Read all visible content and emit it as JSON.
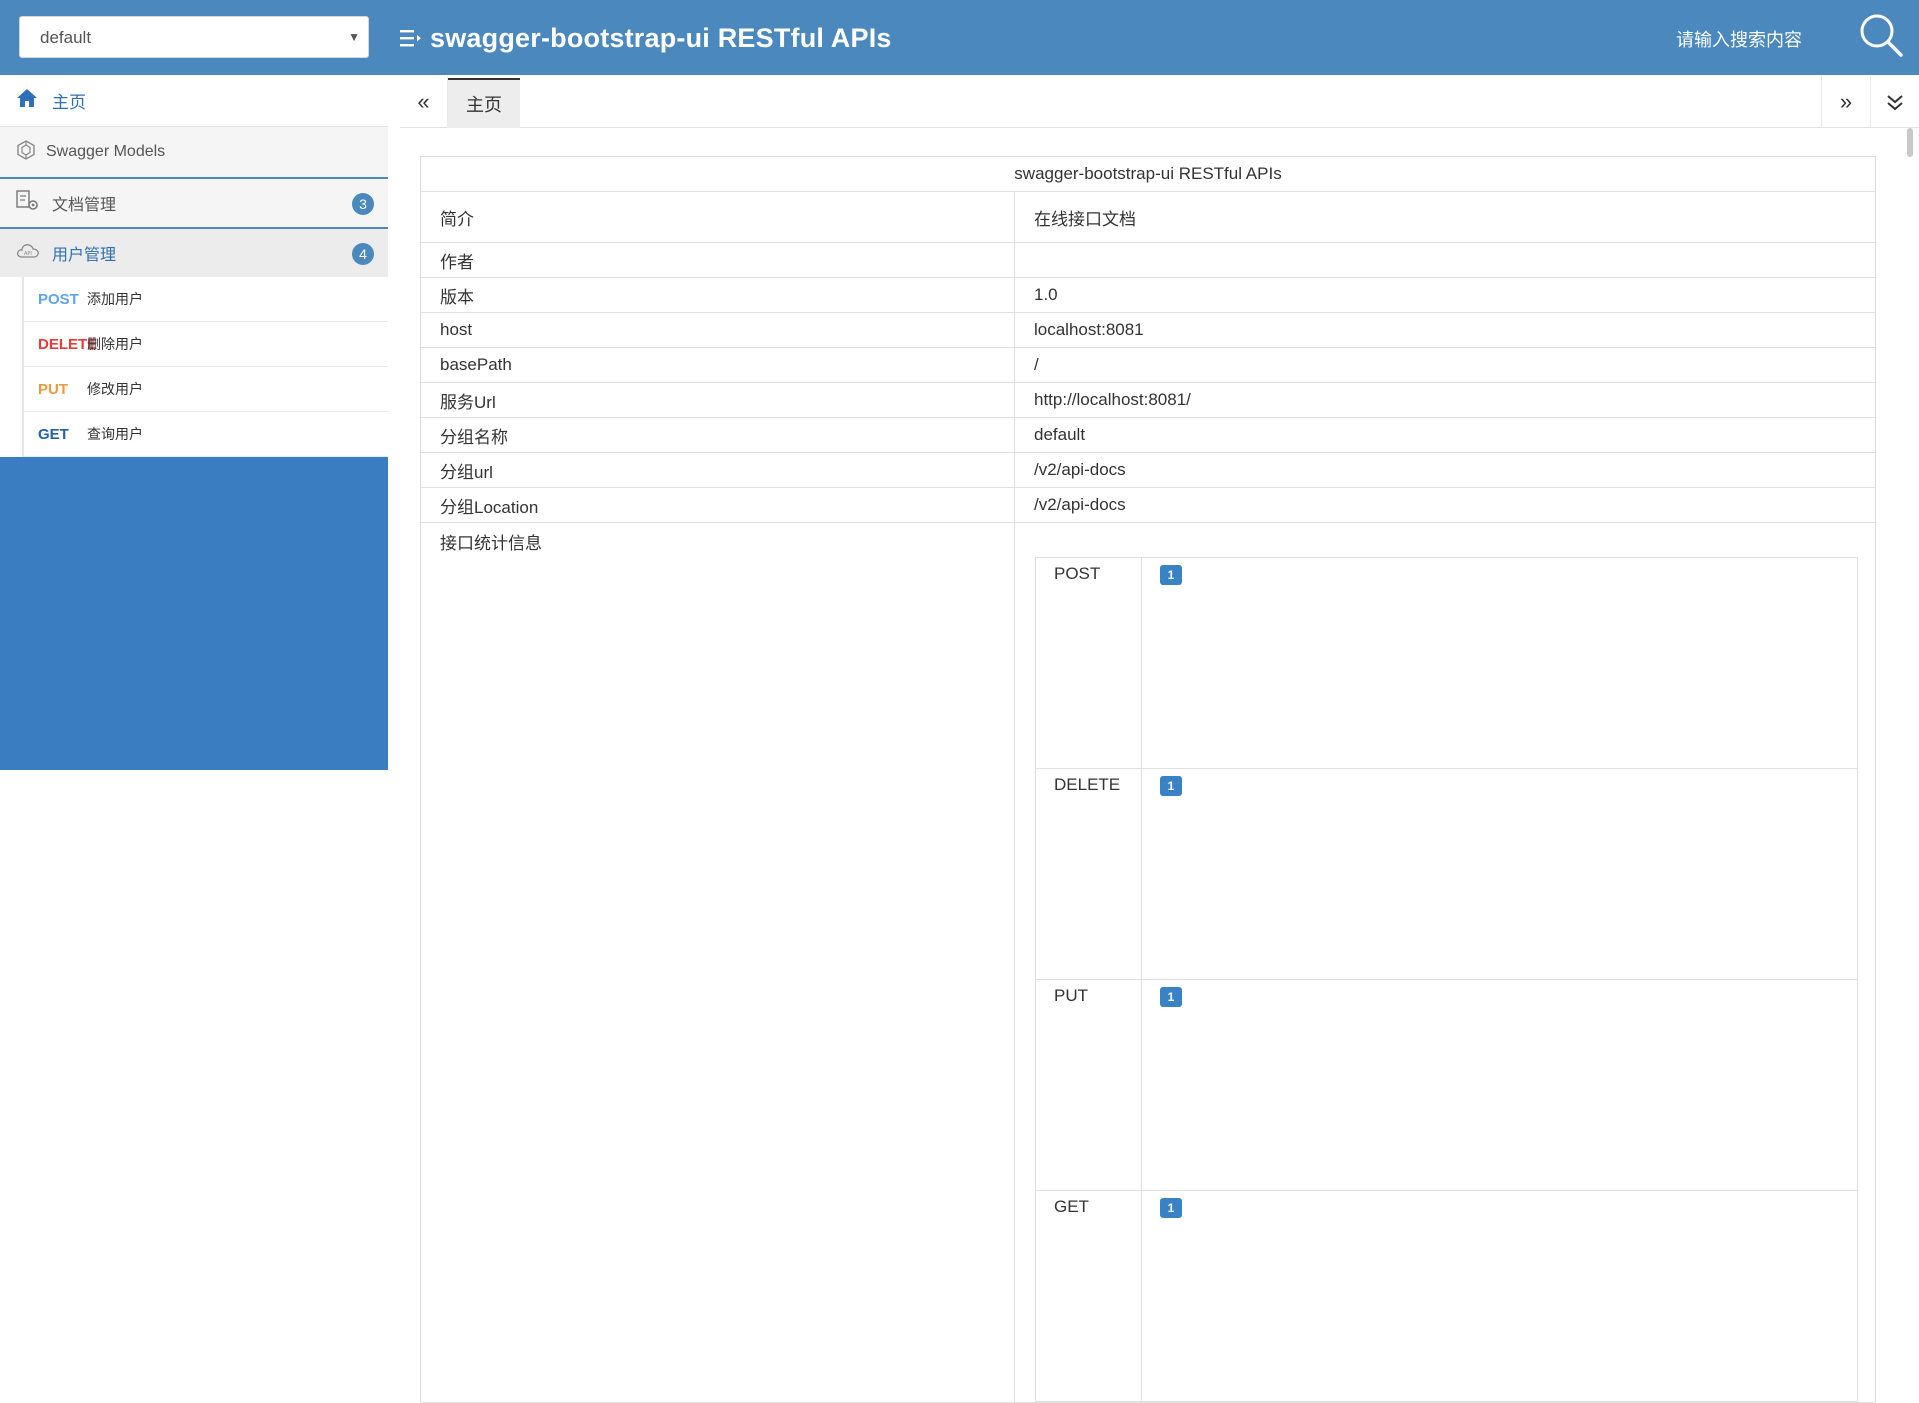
{
  "header": {
    "group_select_value": "default",
    "title": "swagger-bootstrap-ui RESTful APIs",
    "search_placeholder": "请输入搜索内容"
  },
  "sidebar": {
    "home_label": "主页",
    "models_label": "Swagger Models",
    "groups": [
      {
        "label": "文档管理",
        "count": "3"
      },
      {
        "label": "用户管理",
        "count": "4"
      }
    ],
    "endpoints": [
      {
        "method": "POST",
        "name": "添加用户"
      },
      {
        "method": "DELETE",
        "name": "删除用户"
      },
      {
        "method": "PUT",
        "name": "修改用户"
      },
      {
        "method": "GET",
        "name": "查询用户"
      }
    ]
  },
  "tabs": {
    "home_tab": "主页"
  },
  "info_table": {
    "title": "swagger-bootstrap-ui RESTful APIs",
    "rows": [
      {
        "key": "简介",
        "value": "在线接口文档"
      },
      {
        "key": "作者",
        "value": ""
      },
      {
        "key": "版本",
        "value": "1.0"
      },
      {
        "key": "host",
        "value": "localhost:8081"
      },
      {
        "key": "basePath",
        "value": "/"
      },
      {
        "key": "服务Url",
        "value": "http://localhost:8081/"
      },
      {
        "key": "分组名称",
        "value": "default"
      },
      {
        "key": "分组url",
        "value": "/v2/api-docs"
      },
      {
        "key": "分组Location",
        "value": "/v2/api-docs"
      }
    ],
    "stats_key": "接口统计信息",
    "stats": [
      {
        "method": "POST",
        "count": "1"
      },
      {
        "method": "DELETE",
        "count": "1"
      },
      {
        "method": "PUT",
        "count": "1"
      },
      {
        "method": "GET",
        "count": "1"
      }
    ]
  },
  "colors": {
    "header_bg": "#4a88bd",
    "sidebar_bg": "#3a7dc0",
    "post": "#5fa6e8",
    "delete": "#e83a3a",
    "put": "#f0993c",
    "get": "#2361a8"
  },
  "icons": [
    "menu-icon",
    "search-icon",
    "home-icon",
    "models-icon",
    "doc-settings-icon",
    "cloud-api-icon",
    "double-chevron-left-icon",
    "double-chevron-right-icon",
    "double-chevron-down-icon"
  ]
}
